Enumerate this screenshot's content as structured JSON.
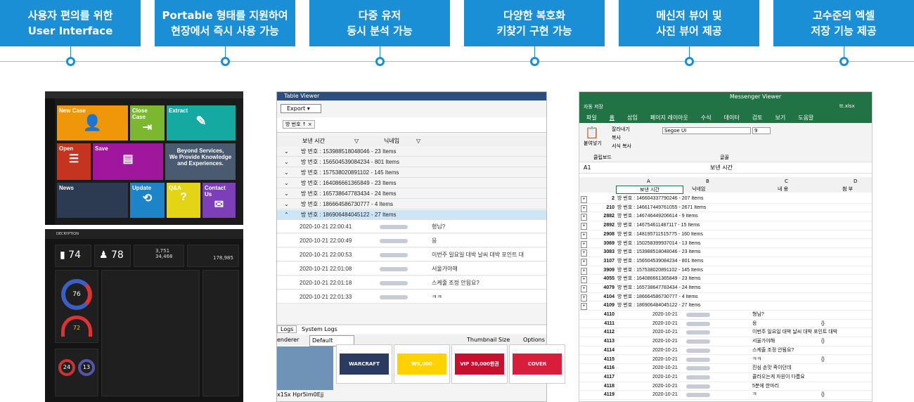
{
  "features": [
    {
      "l1": "사용자 편의를 위한",
      "l2": "User Interface"
    },
    {
      "l1": "Portable 형태를 지원하여",
      "l2": "현장에서 즉시 사용 가능"
    },
    {
      "l1": "다중 유저",
      "l2": "동시 분석 가능"
    },
    {
      "l1": "다양한 복호화",
      "l2": "키찾기 구현 가능"
    },
    {
      "l1": "메신저 뷰어 및",
      "l2": "사진 뷰어 제공"
    },
    {
      "l1": "고수준의 엑셀",
      "l2": "저장 기능 제공"
    }
  ],
  "dashboard": {
    "tiles": [
      "New Case",
      "Close Case",
      "Extract",
      "Open",
      "Save",
      "Beyond Services,",
      "We Provide Knowledge",
      "and Experiences.",
      "News",
      "Update",
      "Q&A",
      "Contact Us"
    ],
    "stats": {
      "pc": "74",
      "users": "78",
      "msg1": "3,751",
      "msg2": "34,468",
      "key": "178,985"
    },
    "decryption": "DECRYPTION",
    "donut1": "76",
    "donut2": "72",
    "donut3": "24",
    "donut4": "13"
  },
  "table_viewer": {
    "title": "Table Viewer",
    "export": "Export",
    "filter": "방 번호 ↑ ×",
    "col_time": "보낸 시간",
    "col_nick": "닉네임",
    "groups": [
      "방 번호 : 153988518048046 - 23 Items",
      "방 번호 : 156504539084234 - 801 Items",
      "방 번호 : 157538020891102 - 145 Items",
      "방 번호 : 164086661365849 - 23 Items",
      "방 번호 : 165738647783434 - 24 Items",
      "방 번호 : 186664586730777 - 4 Items",
      "방 번호 : 186906484045122 - 27 Items"
    ],
    "messages": [
      {
        "time": "2020-10-21 22:00:41",
        "text": "형님?"
      },
      {
        "time": "2020-10-21 22:00:49",
        "text": "응"
      },
      {
        "time": "2020-10-21 22:00:53",
        "text": "이번주 일요일 대박 날씨 대박 포인트 대"
      },
      {
        "time": "2020-10-21 22:01:08",
        "text": "서울가야해"
      },
      {
        "time": "2020-10-21 22:01:18",
        "text": "스케줄 조정 안됨요?"
      },
      {
        "time": "2020-10-21 22:01:33",
        "text": "ㅋㅋ"
      }
    ],
    "tabs": [
      "Logs",
      "System Logs"
    ],
    "renderer": "enderer",
    "default": "Default",
    "thumb_size": "Thumbnail Size",
    "options": "Options",
    "filename": "x1Sx Hpr5im0Ejj",
    "thumbs": [
      "WARCRAFT",
      "₩5,000",
      "VIP 30,000원권",
      "COVER"
    ]
  },
  "messenger": {
    "title": "Messenger Viewer",
    "autosave": "자동 저장",
    "file": "tt.xlsx",
    "tabs": [
      "파일",
      "홈",
      "삽입",
      "페이지 레이아웃",
      "수식",
      "데이터",
      "검토",
      "보기",
      "도움말"
    ],
    "cell": "A1",
    "formula": "보낸 시간",
    "font": "Segoe UI",
    "size": "9",
    "ribbon": [
      "잘라내기",
      "복사",
      "서식 복사",
      "붙여넣기",
      "클립보드",
      "글꼴"
    ],
    "cols": [
      "A",
      "B",
      "C",
      "D"
    ],
    "headers": [
      "보낸 시간",
      "닉네임",
      "내 용",
      "첨 부"
    ],
    "groups": [
      {
        "n": "2",
        "t": "방 번호 : 146604337790246 - 207 Items"
      },
      {
        "n": "210",
        "t": "방 번호 : 146617449761055 - 2671 Items"
      },
      {
        "n": "2882",
        "t": "방 번호 : 146746449206614 - 9 Items"
      },
      {
        "n": "2892",
        "t": "방 번호 : 146754611487117 - 15 Items"
      },
      {
        "n": "2908",
        "t": "방 번호 : 148195711515775 - 160 Items"
      },
      {
        "n": "3069",
        "t": "방 번호 : 150258399937014 - 13 Items"
      },
      {
        "n": "3083",
        "t": "방 번호 : 153988518048046 - 23 Items"
      },
      {
        "n": "3107",
        "t": "방 번호 : 156504539084234 - 801 Items"
      },
      {
        "n": "3909",
        "t": "방 번호 : 157538020891102 - 145 Items"
      },
      {
        "n": "4055",
        "t": "방 번호 : 164086661365849 - 23 Items"
      },
      {
        "n": "4079",
        "t": "방 번호 : 165738647783434 - 24 Items"
      },
      {
        "n": "4104",
        "t": "방 번호 : 186664586730777 - 4 Items"
      },
      {
        "n": "4109",
        "t": "방 번호 : 186906484045122 - 27 Items"
      }
    ],
    "rows": [
      {
        "n": "4110",
        "d": "2020-10-21",
        "c": "형님?",
        "a": ""
      },
      {
        "n": "4111",
        "d": "2020-10-21",
        "c": "응",
        "a": "{}"
      },
      {
        "n": "4112",
        "d": "2020-10-21",
        "c": "이번주 일요일 대박 날씨 대박 포인트 대박",
        "a": ""
      },
      {
        "n": "4113",
        "d": "2020-10-21",
        "c": "서울가야해",
        "a": "{}"
      },
      {
        "n": "4114",
        "d": "2020-10-21",
        "c": "스케줄 조정 안됨요?",
        "a": ""
      },
      {
        "n": "4115",
        "d": "2020-10-21",
        "c": "ㅋㅋ",
        "a": "{}"
      },
      {
        "n": "4116",
        "d": "2020-10-21",
        "c": "진심 손맛 죽이던데",
        "a": ""
      },
      {
        "n": "4117",
        "d": "2020-10-21",
        "c": "콜라오는게 자원이 다름요",
        "a": ""
      },
      {
        "n": "4118",
        "d": "2020-10-21",
        "c": "5분에 한마리",
        "a": ""
      },
      {
        "n": "4119",
        "d": "2020-10-21",
        "c": "ㅋ",
        "a": "{}"
      }
    ]
  }
}
